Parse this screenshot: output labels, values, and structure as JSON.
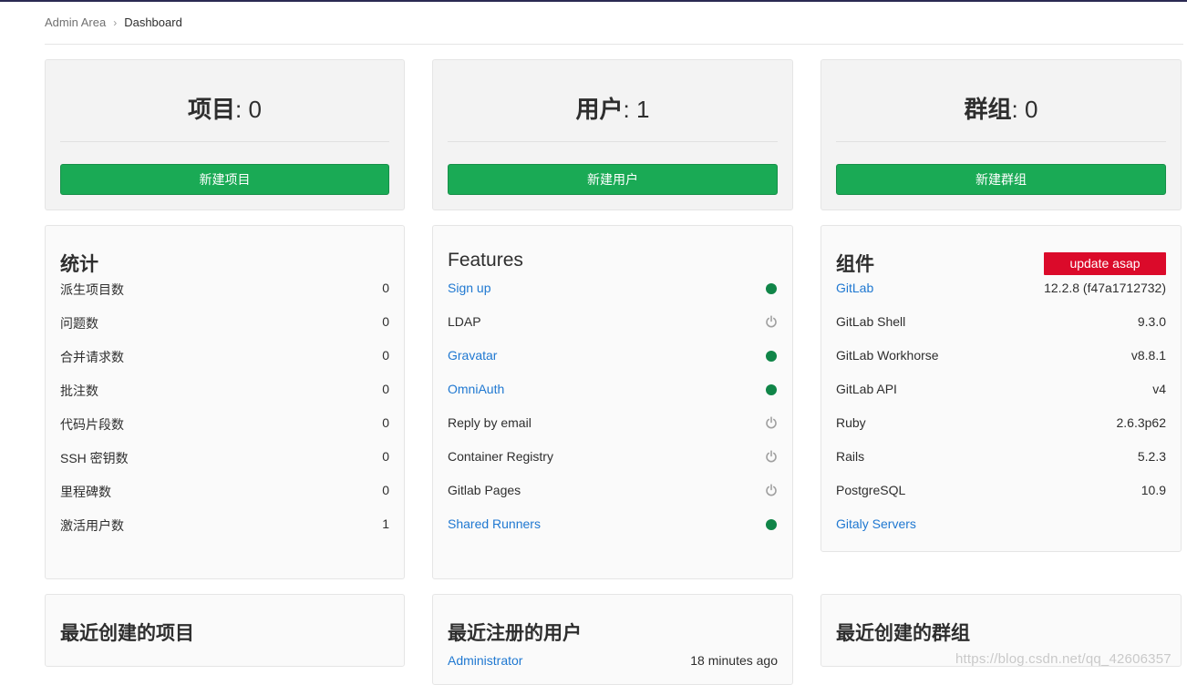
{
  "breadcrumb": {
    "parent": "Admin Area",
    "current": "Dashboard"
  },
  "stats_cards": {
    "projects": {
      "label": "项目",
      "count": ": 0",
      "button": "新建项目"
    },
    "users": {
      "label": "用户",
      "count": ": 1",
      "button": "新建用户"
    },
    "groups": {
      "label": "群组",
      "count": ": 0",
      "button": "新建群组"
    }
  },
  "statistics": {
    "title": "统计",
    "items": [
      {
        "label": "派生项目数",
        "value": "0"
      },
      {
        "label": "问题数",
        "value": "0"
      },
      {
        "label": "合并请求数",
        "value": "0"
      },
      {
        "label": "批注数",
        "value": "0"
      },
      {
        "label": "代码片段数",
        "value": "0"
      },
      {
        "label": "SSH 密钥数",
        "value": "0"
      },
      {
        "label": "里程碑数",
        "value": "0"
      },
      {
        "label": "激活用户数",
        "value": "1"
      }
    ]
  },
  "features": {
    "title": "Features",
    "items": [
      {
        "label": "Sign up",
        "enabled": true
      },
      {
        "label": "LDAP",
        "enabled": false
      },
      {
        "label": "Gravatar",
        "enabled": true
      },
      {
        "label": "OmniAuth",
        "enabled": true
      },
      {
        "label": "Reply by email",
        "enabled": false
      },
      {
        "label": "Container Registry",
        "enabled": false
      },
      {
        "label": "Gitlab Pages",
        "enabled": false
      },
      {
        "label": "Shared Runners",
        "enabled": true
      }
    ],
    "colors": {
      "enabled": "#108548",
      "disabled": "#a0a0a0"
    }
  },
  "components": {
    "title": "组件",
    "badge": "update asap",
    "badge_color": "#db0a2a",
    "items": [
      {
        "label": "GitLab",
        "value": "12.2.8 (f47a1712732)"
      },
      {
        "label": "GitLab Shell",
        "value": "9.3.0"
      },
      {
        "label": "GitLab Workhorse",
        "value": "v8.8.1"
      },
      {
        "label": "GitLab API",
        "value": "v4"
      },
      {
        "label": "Ruby",
        "value": "2.6.3p62"
      },
      {
        "label": "Rails",
        "value": "5.2.3"
      },
      {
        "label": "PostgreSQL",
        "value": "10.9"
      },
      {
        "label": "Gitaly Servers",
        "value": ""
      }
    ]
  },
  "recent": {
    "projects_title": "最近创建的项目",
    "users_title": "最近注册的用户",
    "groups_title": "最近创建的群组",
    "latest_user": {
      "name": "Administrator",
      "time": "18 minutes ago"
    }
  },
  "watermark": "https://blog.csdn.net/qq_42606357"
}
